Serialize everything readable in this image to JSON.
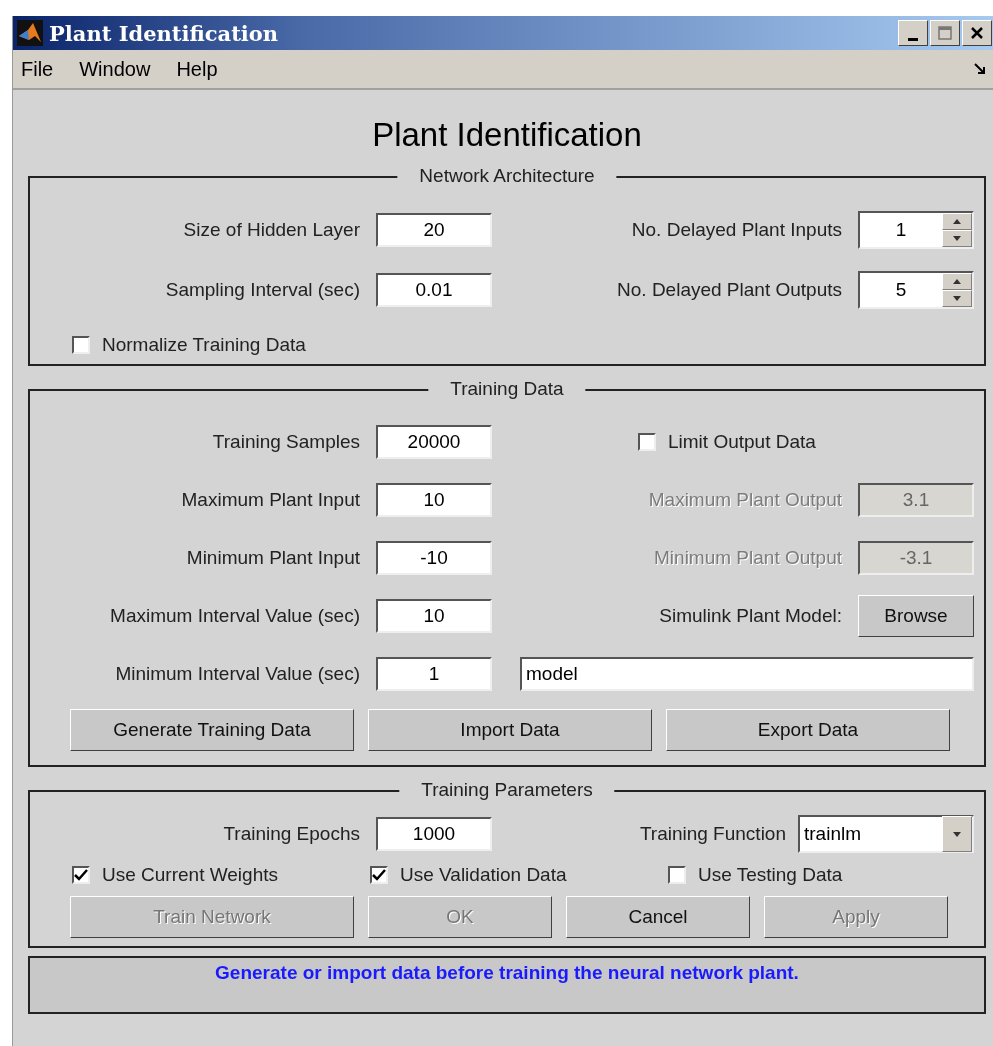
{
  "window": {
    "title": "Plant Identification"
  },
  "menu": [
    "File",
    "Window",
    "Help"
  ],
  "heading": "Plant Identification",
  "network_architecture": {
    "title": "Network Architecture",
    "rows": [
      {
        "left": {
          "label": "Size of Hidden Layer",
          "value": "20"
        },
        "right": {
          "label": "No. Delayed Plant Inputs",
          "value": "1"
        }
      },
      {
        "left": {
          "label": "Sampling Interval (sec)",
          "value": "0.01"
        },
        "right": {
          "label": "No. Delayed Plant Outputs",
          "value": "5"
        }
      }
    ],
    "normalize": {
      "label": "Normalize Training Data",
      "checked": false
    }
  },
  "training_data": {
    "title": "Training Data",
    "fields": [
      {
        "label": "Training Samples",
        "value": "20000"
      },
      {
        "label": "Maximum Plant Input",
        "value": "10"
      },
      {
        "label": "Minimum Plant Input",
        "value": "-10"
      },
      {
        "label": "Maximum Interval Value (sec)",
        "value": "10"
      },
      {
        "label": "Minimum Interval Value (sec)",
        "value": "1"
      }
    ],
    "limit_output": {
      "label": "Limit Output Data",
      "checked": false
    },
    "outputs": [
      {
        "label": "Maximum Plant Output",
        "value": "3.1",
        "disabled": true
      },
      {
        "label": "Minimum Plant Output",
        "value": "-3.1",
        "disabled": true
      }
    ],
    "model_label": "Simulink Plant Model:",
    "browse": "Browse",
    "model": "model",
    "buttons": [
      {
        "label": "Generate Training Data",
        "disabled": false
      },
      {
        "label": "Import Data",
        "disabled": false
      },
      {
        "label": "Export Data",
        "disabled": false
      }
    ]
  },
  "training_parameters": {
    "title": "Training Parameters",
    "epochs": {
      "label": "Training Epochs",
      "value": "1000"
    },
    "function": {
      "label": "Training Function",
      "value": "trainlm"
    },
    "checks": [
      {
        "label": "Use Current Weights",
        "checked": true
      },
      {
        "label": "Use Validation Data",
        "checked": true
      },
      {
        "label": "Use Testing Data",
        "checked": false
      }
    ],
    "buttons": [
      {
        "label": "Train Network",
        "disabled": true
      },
      {
        "label": "OK",
        "disabled": true
      },
      {
        "label": "Cancel",
        "disabled": false
      },
      {
        "label": "Apply",
        "disabled": true
      }
    ]
  },
  "status": "Generate or import data before training the neural network plant."
}
